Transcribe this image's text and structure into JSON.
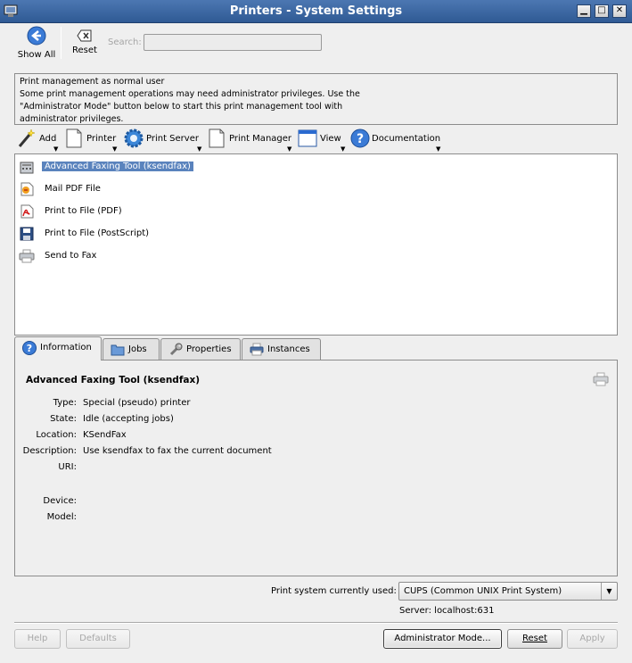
{
  "window": {
    "title": "Printers - System Settings",
    "controls": {
      "minimize": "▁",
      "maximize": "□",
      "close": "✕"
    }
  },
  "toolbar": {
    "show_all_label": "Show All",
    "reset_label": "Reset",
    "search_label": "Search:",
    "search_value": ""
  },
  "info": {
    "line1": "Print management as normal user",
    "line2": "Some print management operations may need administrator privileges. Use the",
    "line3": "\"Administrator Mode\" button below to start this print management tool with",
    "line4": "administrator privileges."
  },
  "actions": [
    {
      "label": "Add",
      "icon": "magic-wand-icon"
    },
    {
      "label": "Printer",
      "icon": "page-icon"
    },
    {
      "label": "Print Server",
      "icon": "gear-icon"
    },
    {
      "label": "Print Manager",
      "icon": "page-icon"
    },
    {
      "label": "View",
      "icon": "window-icon"
    },
    {
      "label": "Documentation",
      "icon": "help-icon"
    }
  ],
  "printers": [
    {
      "name": "Advanced Faxing Tool (ksendfax)",
      "icon": "fax-icon",
      "selected": true
    },
    {
      "name": "Mail PDF File",
      "icon": "mail-pdf-icon",
      "selected": false
    },
    {
      "name": "Print to File (PDF)",
      "icon": "pdf-icon",
      "selected": false
    },
    {
      "name": "Print to File (PostScript)",
      "icon": "floppy-icon",
      "selected": false
    },
    {
      "name": "Send to Fax",
      "icon": "printer-icon",
      "selected": false
    }
  ],
  "tabs": [
    {
      "label": "Information",
      "icon": "help-icon",
      "active": true
    },
    {
      "label": "Jobs",
      "icon": "folder-icon",
      "active": false
    },
    {
      "label": "Properties",
      "icon": "wrench-icon",
      "active": false
    },
    {
      "label": "Instances",
      "icon": "printer-icon",
      "active": false
    }
  ],
  "details": {
    "title": "Advanced Faxing Tool (ksendfax)",
    "type_key": "Type:",
    "type_value": "Special (pseudo) printer",
    "state_key": "State:",
    "state_value": "Idle (accepting jobs)",
    "location_key": "Location:",
    "location_value": "KSendFax",
    "description_key": "Description:",
    "description_value": "Use ksendfax to fax the current document",
    "uri_key": "URI:",
    "uri_value": "",
    "device_key": "Device:",
    "device_value": "",
    "model_key": "Model:",
    "model_value": ""
  },
  "print_system": {
    "label": "Print system currently used:",
    "value": "CUPS (Common UNIX Print System)",
    "server": "Server: localhost:631"
  },
  "buttons": {
    "help": "Help",
    "defaults": "Defaults",
    "admin_mode": "Administrator Mode...",
    "reset": "Reset",
    "apply": "Apply"
  },
  "colors": {
    "titlebar": "#3a66a3",
    "selection": "#5a83bd"
  }
}
